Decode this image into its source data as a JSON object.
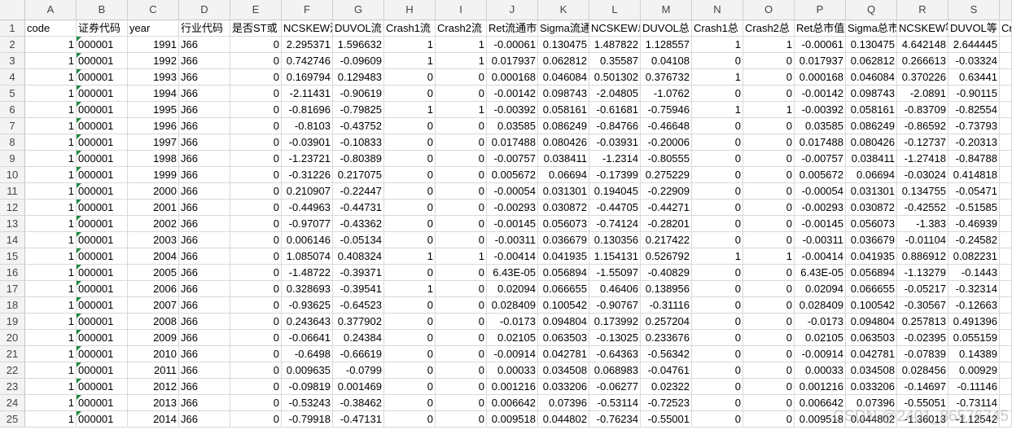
{
  "colors": {
    "gridline": "#d9d9d9",
    "error_indicator": "#1e8a3e"
  },
  "sheet": {
    "columns": [
      "A",
      "B",
      "C",
      "D",
      "E",
      "F",
      "G",
      "H",
      "I",
      "J",
      "K",
      "L",
      "M",
      "N",
      "O",
      "P",
      "Q",
      "R",
      "S"
    ],
    "rows": [
      {
        "num": "1",
        "cells": [
          "code",
          "证券代码",
          "year",
          "行业代码",
          "是否ST或",
          "NCSKEW流",
          "DUVOL流",
          "Crash1流",
          "Crash2流",
          "Ret流通市",
          "Sigma流通",
          "NCSKEW总",
          "DUVOL总",
          "Crash1总",
          "Crash2总",
          "Ret总市值",
          "Sigma总市",
          "NCSKEW等",
          "DUVOL等",
          "Cr"
        ]
      },
      {
        "num": "2",
        "cells": [
          "1",
          "000001",
          "1991",
          "J66",
          "0",
          "2.295371",
          "1.596632",
          "1",
          "1",
          "-0.00061",
          "0.130475",
          "1.487822",
          "1.128557",
          "1",
          "1",
          "-0.00061",
          "0.130475",
          "4.642148",
          "2.644445"
        ]
      },
      {
        "num": "3",
        "cells": [
          "1",
          "000001",
          "1992",
          "J66",
          "0",
          "0.742746",
          "-0.09609",
          "1",
          "1",
          "0.017937",
          "0.062812",
          "0.35587",
          "0.04108",
          "0",
          "0",
          "0.017937",
          "0.062812",
          "0.266613",
          "-0.03324"
        ]
      },
      {
        "num": "4",
        "cells": [
          "1",
          "000001",
          "1993",
          "J66",
          "0",
          "0.169794",
          "0.129483",
          "0",
          "0",
          "0.000168",
          "0.046084",
          "0.501302",
          "0.376732",
          "1",
          "0",
          "0.000168",
          "0.046084",
          "0.370226",
          "0.63441"
        ]
      },
      {
        "num": "5",
        "cells": [
          "1",
          "000001",
          "1994",
          "J66",
          "0",
          "-2.11431",
          "-0.90619",
          "0",
          "0",
          "-0.00142",
          "0.098743",
          "-2.04805",
          "-1.0762",
          "0",
          "0",
          "-0.00142",
          "0.098743",
          "-2.0891",
          "-0.90115"
        ]
      },
      {
        "num": "6",
        "cells": [
          "1",
          "000001",
          "1995",
          "J66",
          "0",
          "-0.81696",
          "-0.79825",
          "1",
          "1",
          "-0.00392",
          "0.058161",
          "-0.61681",
          "-0.75946",
          "1",
          "1",
          "-0.00392",
          "0.058161",
          "-0.83709",
          "-0.82554"
        ]
      },
      {
        "num": "7",
        "cells": [
          "1",
          "000001",
          "1996",
          "J66",
          "0",
          "-0.8103",
          "-0.43752",
          "0",
          "0",
          "0.03585",
          "0.086249",
          "-0.84766",
          "-0.46648",
          "0",
          "0",
          "0.03585",
          "0.086249",
          "-0.86592",
          "-0.73793"
        ]
      },
      {
        "num": "8",
        "cells": [
          "1",
          "000001",
          "1997",
          "J66",
          "0",
          "-0.03901",
          "-0.10833",
          "0",
          "0",
          "0.017488",
          "0.080426",
          "-0.03931",
          "-0.20006",
          "0",
          "0",
          "0.017488",
          "0.080426",
          "-0.12737",
          "-0.20313"
        ]
      },
      {
        "num": "9",
        "cells": [
          "1",
          "000001",
          "1998",
          "J66",
          "0",
          "-1.23721",
          "-0.80389",
          "0",
          "0",
          "-0.00757",
          "0.038411",
          "-1.2314",
          "-0.80555",
          "0",
          "0",
          "-0.00757",
          "0.038411",
          "-1.27418",
          "-0.84788"
        ]
      },
      {
        "num": "10",
        "cells": [
          "1",
          "000001",
          "1999",
          "J66",
          "0",
          "-0.31226",
          "0.217075",
          "0",
          "0",
          "0.005672",
          "0.06694",
          "-0.17399",
          "0.275229",
          "0",
          "0",
          "0.005672",
          "0.06694",
          "-0.03024",
          "0.414818"
        ]
      },
      {
        "num": "11",
        "cells": [
          "1",
          "000001",
          "2000",
          "J66",
          "0",
          "0.210907",
          "-0.22447",
          "0",
          "0",
          "-0.00054",
          "0.031301",
          "0.194045",
          "-0.22909",
          "0",
          "0",
          "-0.00054",
          "0.031301",
          "0.134755",
          "-0.05471"
        ]
      },
      {
        "num": "12",
        "cells": [
          "1",
          "000001",
          "2001",
          "J66",
          "0",
          "-0.44963",
          "-0.44731",
          "0",
          "0",
          "-0.00293",
          "0.030872",
          "-0.44705",
          "-0.44271",
          "0",
          "0",
          "-0.00293",
          "0.030872",
          "-0.42552",
          "-0.51585"
        ]
      },
      {
        "num": "13",
        "cells": [
          "1",
          "000001",
          "2002",
          "J66",
          "0",
          "-0.97077",
          "-0.43362",
          "0",
          "0",
          "-0.00145",
          "0.056073",
          "-0.74124",
          "-0.28201",
          "0",
          "0",
          "-0.00145",
          "0.056073",
          "-1.383",
          "-0.46939"
        ]
      },
      {
        "num": "14",
        "cells": [
          "1",
          "000001",
          "2003",
          "J66",
          "0",
          "0.006146",
          "-0.05134",
          "0",
          "0",
          "-0.00311",
          "0.036679",
          "0.130356",
          "0.217422",
          "0",
          "0",
          "-0.00311",
          "0.036679",
          "-0.01104",
          "-0.24582"
        ]
      },
      {
        "num": "15",
        "cells": [
          "1",
          "000001",
          "2004",
          "J66",
          "0",
          "1.085074",
          "0.408324",
          "1",
          "1",
          "-0.00414",
          "0.041935",
          "1.154131",
          "0.526792",
          "1",
          "1",
          "-0.00414",
          "0.041935",
          "0.886912",
          "0.082231"
        ]
      },
      {
        "num": "16",
        "cells": [
          "1",
          "000001",
          "2005",
          "J66",
          "0",
          "-1.48722",
          "-0.39371",
          "0",
          "0",
          "6.43E-05",
          "0.056894",
          "-1.55097",
          "-0.40829",
          "0",
          "0",
          "6.43E-05",
          "0.056894",
          "-1.13279",
          "-0.1443"
        ]
      },
      {
        "num": "17",
        "cells": [
          "1",
          "000001",
          "2006",
          "J66",
          "0",
          "0.328693",
          "-0.39541",
          "1",
          "0",
          "0.02094",
          "0.066655",
          "0.46406",
          "0.138956",
          "0",
          "0",
          "0.02094",
          "0.066655",
          "-0.05217",
          "-0.32314"
        ]
      },
      {
        "num": "18",
        "cells": [
          "1",
          "000001",
          "2007",
          "J66",
          "0",
          "-0.93625",
          "-0.64523",
          "0",
          "0",
          "0.028409",
          "0.100542",
          "-0.90767",
          "-0.31116",
          "0",
          "0",
          "0.028409",
          "0.100542",
          "-0.30567",
          "-0.12663"
        ]
      },
      {
        "num": "19",
        "cells": [
          "1",
          "000001",
          "2008",
          "J66",
          "0",
          "0.243643",
          "0.377902",
          "0",
          "0",
          "-0.0173",
          "0.094804",
          "0.173992",
          "0.257204",
          "0",
          "0",
          "-0.0173",
          "0.094804",
          "0.257813",
          "0.491396"
        ]
      },
      {
        "num": "20",
        "cells": [
          "1",
          "000001",
          "2009",
          "J66",
          "0",
          "-0.06641",
          "0.24384",
          "0",
          "0",
          "0.02105",
          "0.063503",
          "-0.13025",
          "0.233676",
          "0",
          "0",
          "0.02105",
          "0.063503",
          "-0.02395",
          "0.055159"
        ]
      },
      {
        "num": "21",
        "cells": [
          "1",
          "000001",
          "2010",
          "J66",
          "0",
          "-0.6498",
          "-0.66619",
          "0",
          "0",
          "-0.00914",
          "0.042781",
          "-0.64363",
          "-0.56342",
          "0",
          "0",
          "-0.00914",
          "0.042781",
          "-0.07839",
          "0.14389"
        ]
      },
      {
        "num": "22",
        "cells": [
          "1",
          "000001",
          "2011",
          "J66",
          "0",
          "0.009635",
          "-0.0799",
          "0",
          "0",
          "0.00033",
          "0.034508",
          "0.068983",
          "-0.04761",
          "0",
          "0",
          "0.00033",
          "0.034508",
          "0.028456",
          "0.00929"
        ]
      },
      {
        "num": "23",
        "cells": [
          "1",
          "000001",
          "2012",
          "J66",
          "0",
          "-0.09819",
          "0.001469",
          "0",
          "0",
          "0.001216",
          "0.033206",
          "-0.06277",
          "0.02322",
          "0",
          "0",
          "0.001216",
          "0.033206",
          "-0.14697",
          "-0.11146"
        ]
      },
      {
        "num": "24",
        "cells": [
          "1",
          "000001",
          "2013",
          "J66",
          "0",
          "-0.53243",
          "-0.38462",
          "0",
          "0",
          "0.006642",
          "0.07396",
          "-0.53114",
          "-0.72523",
          "0",
          "0",
          "0.006642",
          "0.07396",
          "-0.55051",
          "-0.73114"
        ]
      },
      {
        "num": "25",
        "cells": [
          "1",
          "000001",
          "2014",
          "J66",
          "0",
          "-0.79918",
          "-0.47131",
          "0",
          "0",
          "0.009518",
          "0.044802",
          "-0.76234",
          "-0.55001",
          "0",
          "0",
          "0.009518",
          "0.044802",
          "-1.36013",
          "-1.12542"
        ]
      }
    ]
  },
  "watermark": "CSDN @2401_86576745"
}
